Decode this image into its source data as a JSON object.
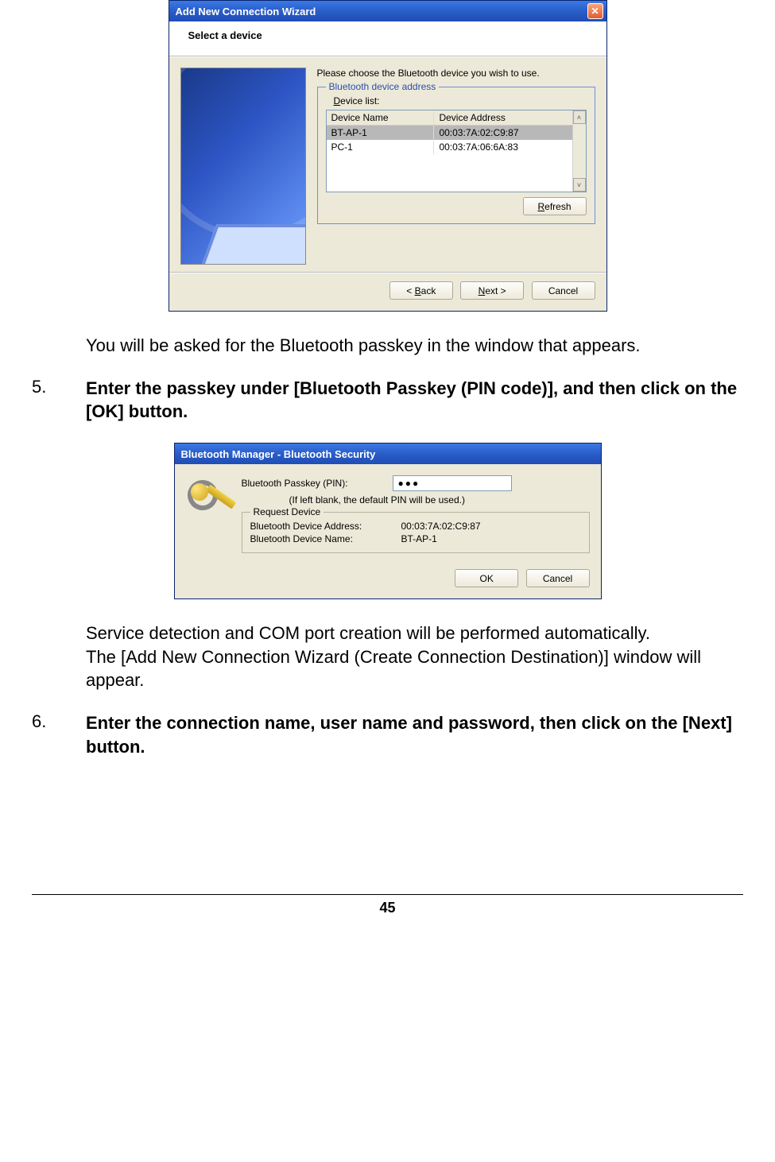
{
  "dialog1": {
    "title": "Add New Connection Wizard",
    "heading": "Select a device",
    "prompt": "Please choose the Bluetooth device you wish to use.",
    "fieldset_legend": "Bluetooth device address",
    "device_list_label": "Device list:",
    "columns": {
      "name": "Device Name",
      "addr": "Device Address"
    },
    "rows": [
      {
        "name": "BT-AP-1",
        "addr": "00:03:7A:02:C9:87",
        "selected": true
      },
      {
        "name": "PC-1",
        "addr": "00:03:7A:06:6A:83",
        "selected": false
      }
    ],
    "refresh": "Refresh",
    "back": "< Back",
    "next": "Next >",
    "cancel": "Cancel"
  },
  "paragraph1": "You will be asked for the Bluetooth passkey in the window that appears.",
  "step5": {
    "num": "5.",
    "text": "Enter the passkey under [Bluetooth Passkey (PIN code)], and then click on the [OK] button."
  },
  "dialog2": {
    "title": "Bluetooth Manager  -  Bluetooth Security",
    "pin_label": "Bluetooth Passkey (PIN):",
    "pin_value": "●●●",
    "pin_hint": "(If left blank, the default PIN will be used.)",
    "fieldset_legend": "Request Device",
    "addr_label": "Bluetooth Device Address:",
    "addr_value": "00:03:7A:02:C9:87",
    "name_label": "Bluetooth Device Name:",
    "name_value": "BT-AP-1",
    "ok": "OK",
    "cancel": "Cancel"
  },
  "paragraph2a": "Service detection and COM port creation will be performed automatically.",
  "paragraph2b": "The [Add New Connection Wizard (Create Connection Destination)] window will appear.",
  "step6": {
    "num": "6.",
    "text": "Enter the connection name, user name and password, then click on the [Next] button."
  },
  "page_number": "45"
}
